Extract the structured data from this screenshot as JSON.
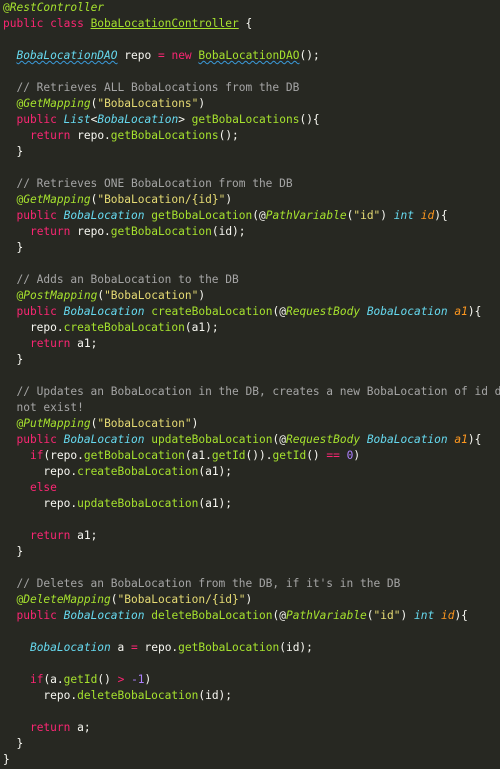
{
  "editor": {
    "theme": {
      "background": "#272822",
      "foreground": "#f8f8f2",
      "keyword": "#f92672",
      "type": "#66d9ef",
      "function": "#a6e22e",
      "string": "#e6db74",
      "param": "#fd971f",
      "number": "#ae81ff",
      "comment": "#a5a5a5"
    },
    "lines": [
      [
        {
          "t": "@",
          "c": "tok-annotation"
        },
        {
          "t": "RestController",
          "c": "tok-annotation-type"
        }
      ],
      [
        {
          "t": "public class ",
          "c": "tok-keyword"
        },
        {
          "t": "BobaLocationController",
          "c": "tok-class"
        },
        {
          "t": " {",
          "c": "tok-plain"
        }
      ],
      [],
      [
        {
          "t": "  ",
          "c": "tok-plain"
        },
        {
          "t": "BobaLocationDAO",
          "c": "tok-classref squiggle"
        },
        {
          "t": " repo ",
          "c": "tok-plain"
        },
        {
          "t": "=",
          "c": "tok-op"
        },
        {
          "t": " ",
          "c": "tok-plain"
        },
        {
          "t": "new",
          "c": "tok-keyword"
        },
        {
          "t": " ",
          "c": "tok-plain"
        },
        {
          "t": "BobaLocationDAO",
          "c": "tok-method squiggle"
        },
        {
          "t": "();",
          "c": "tok-plain"
        }
      ],
      [],
      [
        {
          "t": "  // Retrieves ALL BobaLocations from the DB",
          "c": "tok-comment"
        }
      ],
      [
        {
          "t": "  @",
          "c": "tok-annotation"
        },
        {
          "t": "GetMapping",
          "c": "tok-annotation-type"
        },
        {
          "t": "(",
          "c": "tok-plain"
        },
        {
          "t": "\"BobaLocations\"",
          "c": "tok-string"
        },
        {
          "t": ")",
          "c": "tok-plain"
        }
      ],
      [
        {
          "t": "  ",
          "c": "tok-plain"
        },
        {
          "t": "public",
          "c": "tok-keyword"
        },
        {
          "t": " ",
          "c": "tok-plain"
        },
        {
          "t": "List",
          "c": "tok-type"
        },
        {
          "t": "<",
          "c": "tok-plain"
        },
        {
          "t": "BobaLocation",
          "c": "tok-type"
        },
        {
          "t": "> ",
          "c": "tok-plain"
        },
        {
          "t": "getBobaLocations",
          "c": "tok-method"
        },
        {
          "t": "(){",
          "c": "tok-plain"
        }
      ],
      [
        {
          "t": "    ",
          "c": "tok-plain"
        },
        {
          "t": "return",
          "c": "tok-keyword"
        },
        {
          "t": " repo.",
          "c": "tok-plain"
        },
        {
          "t": "getBobaLocations",
          "c": "tok-method"
        },
        {
          "t": "();",
          "c": "tok-plain"
        }
      ],
      [
        {
          "t": "  }",
          "c": "tok-plain"
        }
      ],
      [],
      [
        {
          "t": "  // Retrieves ONE BobaLocation from the DB",
          "c": "tok-comment"
        }
      ],
      [
        {
          "t": "  @",
          "c": "tok-annotation"
        },
        {
          "t": "GetMapping",
          "c": "tok-annotation-type"
        },
        {
          "t": "(",
          "c": "tok-plain"
        },
        {
          "t": "\"BobaLocation/{id}\"",
          "c": "tok-string"
        },
        {
          "t": ")",
          "c": "tok-plain"
        }
      ],
      [
        {
          "t": "  ",
          "c": "tok-plain"
        },
        {
          "t": "public",
          "c": "tok-keyword"
        },
        {
          "t": " ",
          "c": "tok-plain"
        },
        {
          "t": "BobaLocation",
          "c": "tok-type"
        },
        {
          "t": " ",
          "c": "tok-plain"
        },
        {
          "t": "getBobaLocation",
          "c": "tok-method"
        },
        {
          "t": "(@",
          "c": "tok-plain"
        },
        {
          "t": "PathVariable",
          "c": "tok-annotation-type"
        },
        {
          "t": "(",
          "c": "tok-plain"
        },
        {
          "t": "\"id\"",
          "c": "tok-string"
        },
        {
          "t": ") ",
          "c": "tok-plain"
        },
        {
          "t": "int",
          "c": "tok-type"
        },
        {
          "t": " ",
          "c": "tok-plain"
        },
        {
          "t": "id",
          "c": "tok-param"
        },
        {
          "t": "){",
          "c": "tok-plain"
        }
      ],
      [
        {
          "t": "    ",
          "c": "tok-plain"
        },
        {
          "t": "return",
          "c": "tok-keyword"
        },
        {
          "t": " repo.",
          "c": "tok-plain"
        },
        {
          "t": "getBobaLocation",
          "c": "tok-method"
        },
        {
          "t": "(id);",
          "c": "tok-plain"
        }
      ],
      [
        {
          "t": "  }",
          "c": "tok-plain"
        }
      ],
      [],
      [
        {
          "t": "  // Adds an BobaLocation to the DB",
          "c": "tok-comment"
        }
      ],
      [
        {
          "t": "  @",
          "c": "tok-annotation"
        },
        {
          "t": "PostMapping",
          "c": "tok-annotation-type"
        },
        {
          "t": "(",
          "c": "tok-plain"
        },
        {
          "t": "\"BobaLocation\"",
          "c": "tok-string"
        },
        {
          "t": ")",
          "c": "tok-plain"
        }
      ],
      [
        {
          "t": "  ",
          "c": "tok-plain"
        },
        {
          "t": "public",
          "c": "tok-keyword"
        },
        {
          "t": " ",
          "c": "tok-plain"
        },
        {
          "t": "BobaLocation",
          "c": "tok-type"
        },
        {
          "t": " ",
          "c": "tok-plain"
        },
        {
          "t": "createBobaLocation",
          "c": "tok-method"
        },
        {
          "t": "(@",
          "c": "tok-plain"
        },
        {
          "t": "RequestBody",
          "c": "tok-annotation-type"
        },
        {
          "t": " ",
          "c": "tok-plain"
        },
        {
          "t": "BobaLocation",
          "c": "tok-type"
        },
        {
          "t": " ",
          "c": "tok-plain"
        },
        {
          "t": "a1",
          "c": "tok-param"
        },
        {
          "t": "){",
          "c": "tok-plain"
        }
      ],
      [
        {
          "t": "    repo.",
          "c": "tok-plain"
        },
        {
          "t": "createBobaLocation",
          "c": "tok-method"
        },
        {
          "t": "(a1);",
          "c": "tok-plain"
        }
      ],
      [
        {
          "t": "    ",
          "c": "tok-plain"
        },
        {
          "t": "return",
          "c": "tok-keyword"
        },
        {
          "t": " a1;",
          "c": "tok-plain"
        }
      ],
      [
        {
          "t": "  }",
          "c": "tok-plain"
        }
      ],
      [],
      [
        {
          "t": "  // Updates an BobaLocation in the DB, creates a new BobaLocation of id does",
          "c": "tok-comment"
        }
      ],
      [
        {
          "t": "  not exist!",
          "c": "tok-comment"
        }
      ],
      [
        {
          "t": "  @",
          "c": "tok-annotation"
        },
        {
          "t": "PutMapping",
          "c": "tok-annotation-type"
        },
        {
          "t": "(",
          "c": "tok-plain"
        },
        {
          "t": "\"BobaLocation\"",
          "c": "tok-string"
        },
        {
          "t": ")",
          "c": "tok-plain"
        }
      ],
      [
        {
          "t": "  ",
          "c": "tok-plain"
        },
        {
          "t": "public",
          "c": "tok-keyword"
        },
        {
          "t": " ",
          "c": "tok-plain"
        },
        {
          "t": "BobaLocation",
          "c": "tok-type"
        },
        {
          "t": " ",
          "c": "tok-plain"
        },
        {
          "t": "updateBobaLocation",
          "c": "tok-method"
        },
        {
          "t": "(@",
          "c": "tok-plain"
        },
        {
          "t": "RequestBody",
          "c": "tok-annotation-type"
        },
        {
          "t": " ",
          "c": "tok-plain"
        },
        {
          "t": "BobaLocation",
          "c": "tok-type"
        },
        {
          "t": " ",
          "c": "tok-plain"
        },
        {
          "t": "a1",
          "c": "tok-param"
        },
        {
          "t": "){",
          "c": "tok-plain"
        }
      ],
      [
        {
          "t": "    ",
          "c": "tok-plain"
        },
        {
          "t": "if",
          "c": "tok-keyword"
        },
        {
          "t": "(repo.",
          "c": "tok-plain"
        },
        {
          "t": "getBobaLocation",
          "c": "tok-method"
        },
        {
          "t": "(a1.",
          "c": "tok-plain"
        },
        {
          "t": "getId",
          "c": "tok-method"
        },
        {
          "t": "()).",
          "c": "tok-plain"
        },
        {
          "t": "getId",
          "c": "tok-method"
        },
        {
          "t": "() ",
          "c": "tok-plain"
        },
        {
          "t": "==",
          "c": "tok-op"
        },
        {
          "t": " ",
          "c": "tok-plain"
        },
        {
          "t": "0",
          "c": "tok-number"
        },
        {
          "t": ")",
          "c": "tok-plain"
        }
      ],
      [
        {
          "t": "      repo.",
          "c": "tok-plain"
        },
        {
          "t": "createBobaLocation",
          "c": "tok-method"
        },
        {
          "t": "(a1);",
          "c": "tok-plain"
        }
      ],
      [
        {
          "t": "    ",
          "c": "tok-plain"
        },
        {
          "t": "else",
          "c": "tok-keyword"
        }
      ],
      [
        {
          "t": "      repo.",
          "c": "tok-plain"
        },
        {
          "t": "updateBobaLocation",
          "c": "tok-method"
        },
        {
          "t": "(a1);",
          "c": "tok-plain"
        }
      ],
      [],
      [
        {
          "t": "    ",
          "c": "tok-plain"
        },
        {
          "t": "return",
          "c": "tok-keyword"
        },
        {
          "t": " a1;",
          "c": "tok-plain"
        }
      ],
      [
        {
          "t": "  }",
          "c": "tok-plain"
        }
      ],
      [],
      [
        {
          "t": "  // Deletes an BobaLocation from the DB, if it's in the DB",
          "c": "tok-comment"
        }
      ],
      [
        {
          "t": "  @",
          "c": "tok-annotation"
        },
        {
          "t": "DeleteMapping",
          "c": "tok-annotation-type"
        },
        {
          "t": "(",
          "c": "tok-plain"
        },
        {
          "t": "\"BobaLocation/{id}\"",
          "c": "tok-string"
        },
        {
          "t": ")",
          "c": "tok-plain"
        }
      ],
      [
        {
          "t": "  ",
          "c": "tok-plain"
        },
        {
          "t": "public",
          "c": "tok-keyword"
        },
        {
          "t": " ",
          "c": "tok-plain"
        },
        {
          "t": "BobaLocation",
          "c": "tok-type"
        },
        {
          "t": " ",
          "c": "tok-plain"
        },
        {
          "t": "deleteBobaLocation",
          "c": "tok-method"
        },
        {
          "t": "(@",
          "c": "tok-plain"
        },
        {
          "t": "PathVariable",
          "c": "tok-annotation-type"
        },
        {
          "t": "(",
          "c": "tok-plain"
        },
        {
          "t": "\"id\"",
          "c": "tok-string"
        },
        {
          "t": ") ",
          "c": "tok-plain"
        },
        {
          "t": "int",
          "c": "tok-type"
        },
        {
          "t": " ",
          "c": "tok-plain"
        },
        {
          "t": "id",
          "c": "tok-param"
        },
        {
          "t": "){",
          "c": "tok-plain"
        }
      ],
      [],
      [
        {
          "t": "    ",
          "c": "tok-plain"
        },
        {
          "t": "BobaLocation",
          "c": "tok-type"
        },
        {
          "t": " a ",
          "c": "tok-plain"
        },
        {
          "t": "=",
          "c": "tok-op"
        },
        {
          "t": " repo.",
          "c": "tok-plain"
        },
        {
          "t": "getBobaLocation",
          "c": "tok-method"
        },
        {
          "t": "(id);",
          "c": "tok-plain"
        }
      ],
      [],
      [
        {
          "t": "    ",
          "c": "tok-plain"
        },
        {
          "t": "if",
          "c": "tok-keyword"
        },
        {
          "t": "(a.",
          "c": "tok-plain"
        },
        {
          "t": "getId",
          "c": "tok-method"
        },
        {
          "t": "() ",
          "c": "tok-plain"
        },
        {
          "t": ">",
          "c": "tok-op"
        },
        {
          "t": " ",
          "c": "tok-plain"
        },
        {
          "t": "-1",
          "c": "tok-number"
        },
        {
          "t": ")",
          "c": "tok-plain"
        }
      ],
      [
        {
          "t": "      repo.",
          "c": "tok-plain"
        },
        {
          "t": "deleteBobaLocation",
          "c": "tok-method"
        },
        {
          "t": "(id);",
          "c": "tok-plain"
        }
      ],
      [],
      [
        {
          "t": "    ",
          "c": "tok-plain"
        },
        {
          "t": "return",
          "c": "tok-keyword"
        },
        {
          "t": " a;",
          "c": "tok-plain"
        }
      ],
      [
        {
          "t": "  }",
          "c": "tok-plain"
        }
      ],
      [
        {
          "t": "}",
          "c": "tok-plain"
        }
      ]
    ]
  }
}
